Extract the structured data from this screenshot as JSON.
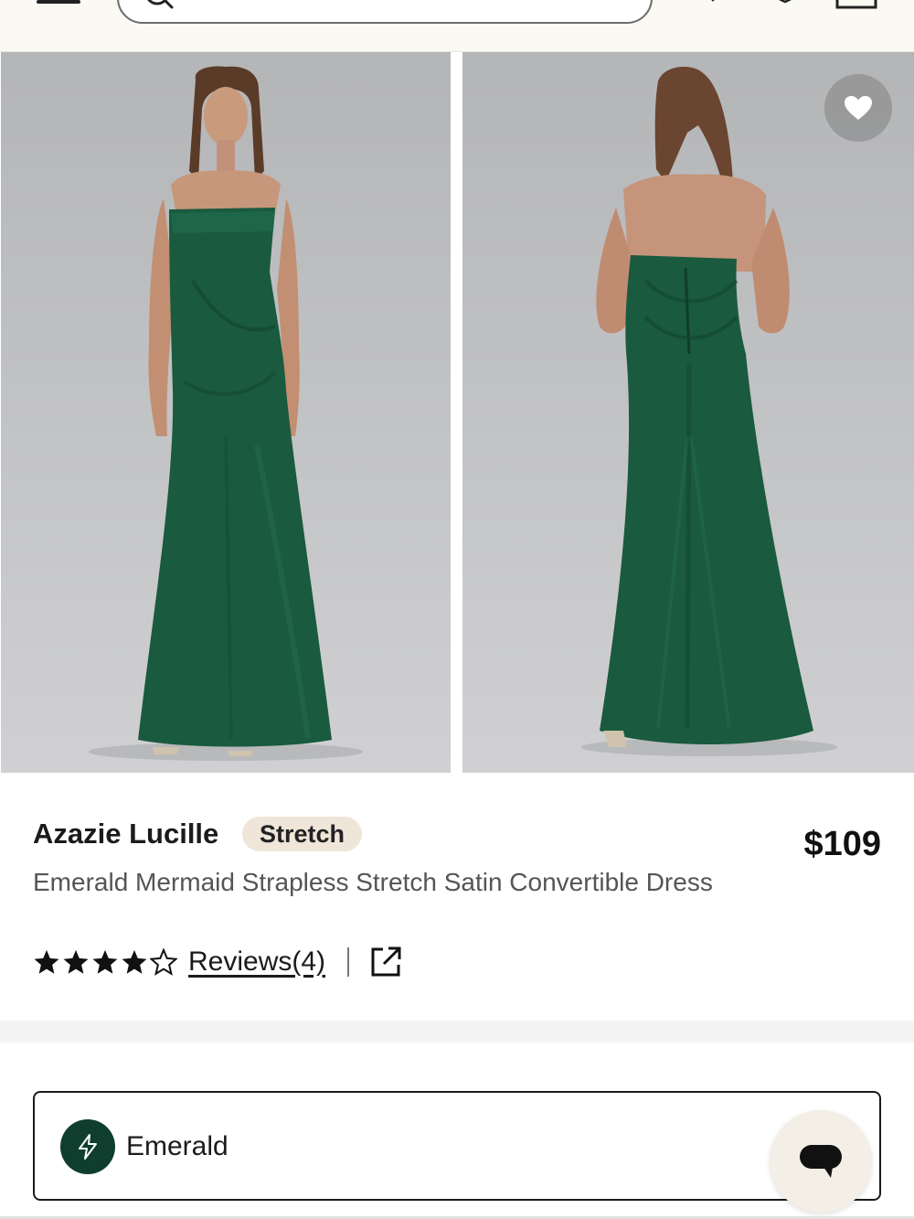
{
  "header": {
    "menu_icon": "hamburger-icon",
    "search_icon": "search-icon",
    "icons": [
      "message-icon",
      "heart-icon",
      "shopping-bag-icon"
    ]
  },
  "gallery": {
    "images": [
      {
        "alt": "front",
        "view": "front"
      },
      {
        "alt": "back",
        "view": "back"
      }
    ],
    "favorite_icon": "heart-icon"
  },
  "product": {
    "brand": "Azazie Lucille",
    "badge": "Stretch",
    "price": "$109",
    "description": "Emerald Mermaid Strapless Stretch Satin Convertible Dress",
    "rating": 4,
    "rating_max": 5,
    "reviews_label": "Reviews(4)"
  },
  "color_selector": {
    "selected": "Emerald",
    "swatch_color": "#0f3d2e",
    "icon": "lightning-icon"
  },
  "chat": {
    "icon": "chat-bubble-icon"
  },
  "colors": {
    "dress": "#1a5a3e",
    "accent_badge": "#efe6d9",
    "header_bg": "#fbfaf2"
  }
}
